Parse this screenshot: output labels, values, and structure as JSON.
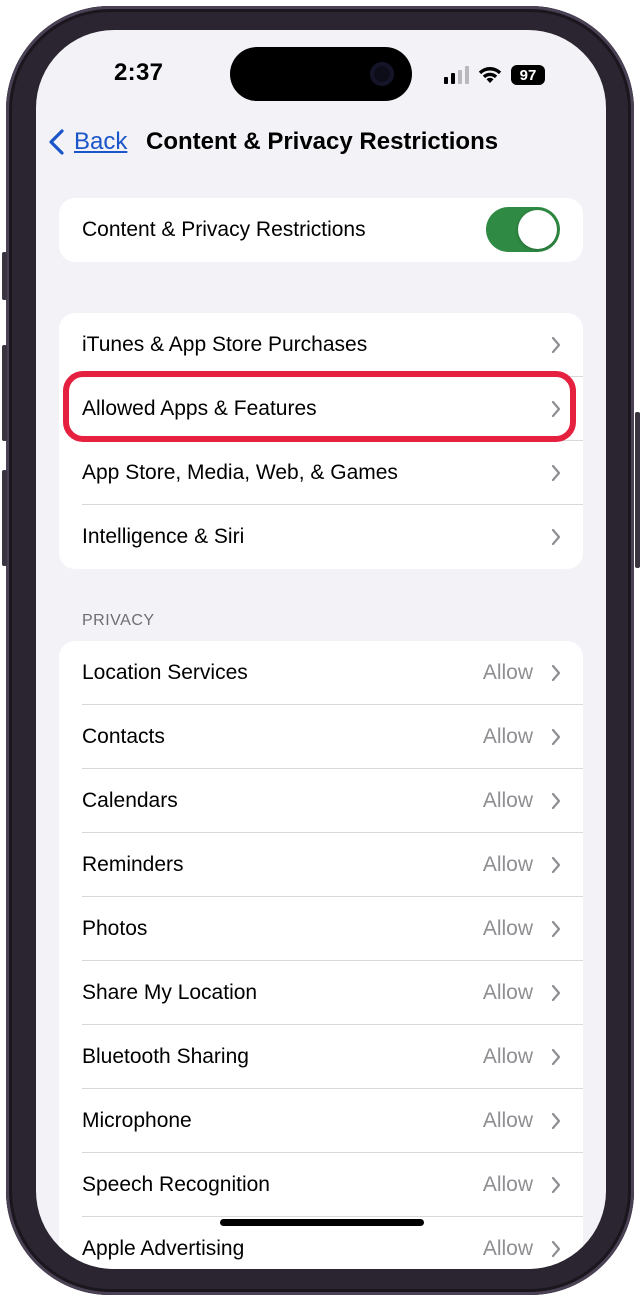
{
  "status_bar": {
    "time": "2:37",
    "battery": "97"
  },
  "nav": {
    "back_label": "Back",
    "title": "Content & Privacy Restrictions"
  },
  "toggle_row": {
    "label": "Content & Privacy Restrictions",
    "enabled": true
  },
  "menu_items": [
    {
      "label": "iTunes & App Store Purchases"
    },
    {
      "label": "Allowed Apps & Features",
      "highlighted": true
    },
    {
      "label": "App Store, Media, Web, & Games"
    },
    {
      "label": "Intelligence & Siri"
    }
  ],
  "privacy": {
    "header": "PRIVACY",
    "items": [
      {
        "label": "Location Services",
        "value": "Allow"
      },
      {
        "label": "Contacts",
        "value": "Allow"
      },
      {
        "label": "Calendars",
        "value": "Allow"
      },
      {
        "label": "Reminders",
        "value": "Allow"
      },
      {
        "label": "Photos",
        "value": "Allow"
      },
      {
        "label": "Share My Location",
        "value": "Allow"
      },
      {
        "label": "Bluetooth Sharing",
        "value": "Allow"
      },
      {
        "label": "Microphone",
        "value": "Allow"
      },
      {
        "label": "Speech Recognition",
        "value": "Allow"
      },
      {
        "label": "Apple Advertising",
        "value": "Allow"
      }
    ]
  },
  "colors": {
    "accent": "#1a55c9",
    "toggle_on": "#2f8a43",
    "highlight": "#e5213f"
  }
}
